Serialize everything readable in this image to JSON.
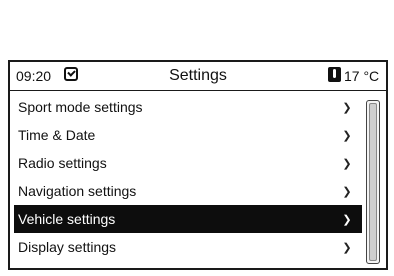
{
  "status": {
    "time": "09:20",
    "title": "Settings",
    "temperature": "17 °C"
  },
  "menu": {
    "items": [
      {
        "label": "Sport mode settings",
        "selected": false
      },
      {
        "label": "Time & Date",
        "selected": false
      },
      {
        "label": "Radio settings",
        "selected": false
      },
      {
        "label": "Navigation settings",
        "selected": false
      },
      {
        "label": "Vehicle settings",
        "selected": true
      },
      {
        "label": "Display settings",
        "selected": false
      }
    ],
    "chevron": "❯"
  },
  "icons": {
    "clock": "clock-check-icon",
    "temperature": "thermometer-icon"
  }
}
